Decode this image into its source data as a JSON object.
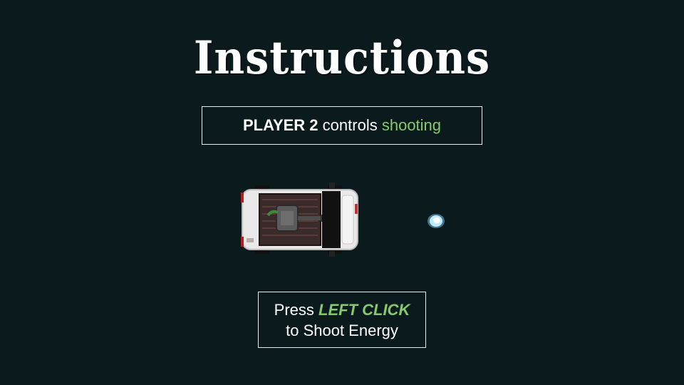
{
  "title": "Instructions",
  "player_box": {
    "player": "PLAYER 2",
    "verb": "controls",
    "action": "shooting"
  },
  "hint_box": {
    "press": "Press",
    "key": "LEFT CLICK",
    "line2": "to Shoot Energy"
  },
  "colors": {
    "background": "#0b1a1c",
    "accent_green": "#86c96e",
    "text": "#ffffff",
    "energy": "#aee8ff"
  },
  "icons": {
    "car": "armored-car-with-turret-icon",
    "projectile": "energy-ball-icon"
  }
}
